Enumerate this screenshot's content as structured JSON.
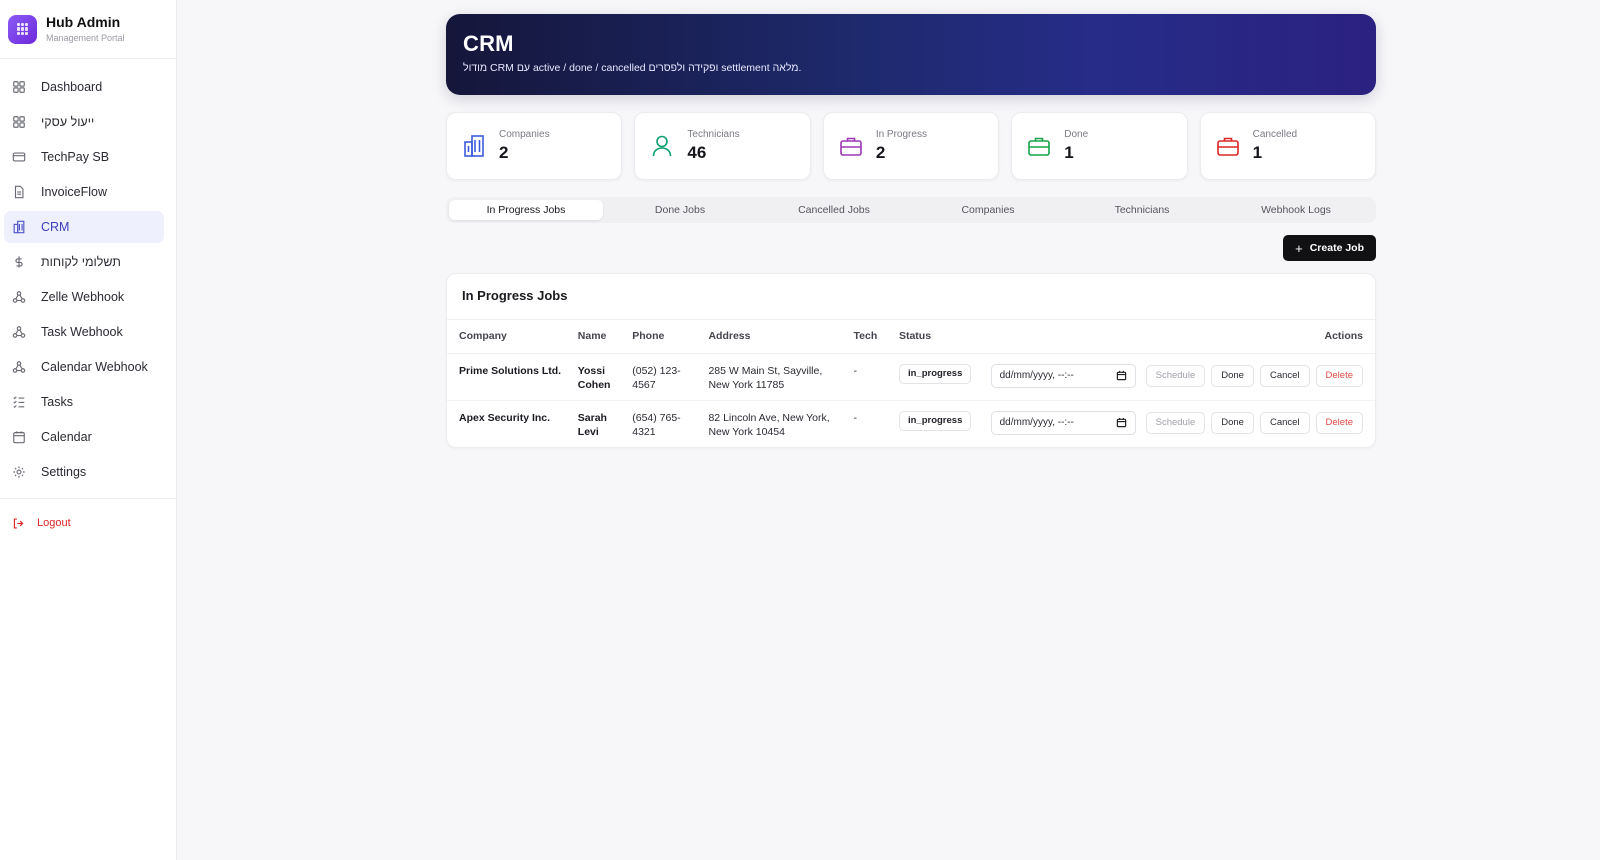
{
  "sidebar": {
    "brand": {
      "title": "Hub Admin",
      "subtitle": "Management Portal"
    },
    "items": [
      {
        "label": "Dashboard",
        "icon": "dashboard-icon",
        "active": false
      },
      {
        "label": "ייעול עסקי",
        "icon": "grid-icon",
        "active": false
      },
      {
        "label": "TechPay SB",
        "icon": "credit-card-icon",
        "active": false
      },
      {
        "label": "InvoiceFlow",
        "icon": "document-icon",
        "active": false
      },
      {
        "label": "CRM",
        "icon": "building-icon",
        "active": true
      },
      {
        "label": "תשלומי לקוחות",
        "icon": "dollar-icon",
        "active": false
      },
      {
        "label": "Zelle Webhook",
        "icon": "webhook-icon",
        "active": false
      },
      {
        "label": "Task Webhook",
        "icon": "webhook-icon",
        "active": false
      },
      {
        "label": "Calendar Webhook",
        "icon": "webhook-icon",
        "active": false
      },
      {
        "label": "Tasks",
        "icon": "list-icon",
        "active": false
      },
      {
        "label": "Calendar",
        "icon": "calendar-icon",
        "active": false
      },
      {
        "label": "Settings",
        "icon": "gear-icon",
        "active": false
      }
    ],
    "logout": "Logout"
  },
  "hero": {
    "title": "CRM",
    "subtitle": "מודול CRM עם active / done / cancelled ופקידה ולפסרים settlement מלאה."
  },
  "stats": [
    {
      "label": "Companies",
      "value": "2",
      "icon": "building-icon",
      "color": "#3b5bdb"
    },
    {
      "label": "Technicians",
      "value": "46",
      "icon": "user-icon",
      "color": "#0f9f6e"
    },
    {
      "label": "In Progress",
      "value": "2",
      "icon": "briefcase-icon",
      "color": "#9c36b5"
    },
    {
      "label": "Done",
      "value": "1",
      "icon": "briefcase-icon",
      "color": "#16a34a"
    },
    {
      "label": "Cancelled",
      "value": "1",
      "icon": "briefcase-icon",
      "color": "#dc2626"
    }
  ],
  "tabs": [
    {
      "label": "In Progress Jobs",
      "active": true
    },
    {
      "label": "Done Jobs",
      "active": false
    },
    {
      "label": "Cancelled Jobs",
      "active": false
    },
    {
      "label": "Companies",
      "active": false
    },
    {
      "label": "Technicians",
      "active": false
    },
    {
      "label": "Webhook Logs",
      "active": false
    }
  ],
  "toolbar": {
    "create_label": "Create Job"
  },
  "jobs": {
    "title": "In Progress Jobs",
    "columns": {
      "company": "Company",
      "name": "Name",
      "phone": "Phone",
      "address": "Address",
      "tech": "Tech",
      "status": "Status",
      "actions": "Actions"
    },
    "actions": {
      "schedule": "Schedule",
      "done": "Done",
      "cancel": "Cancel",
      "delete": "Delete"
    },
    "date_placeholder": "dd/mm/yyyy, --:--",
    "rows": [
      {
        "company": "Prime Solutions Ltd.",
        "name": "Yossi Cohen",
        "phone": "(052) 123-4567",
        "address": "285 W Main St, Sayville, New York 11785",
        "tech": "-",
        "status": "in_progress"
      },
      {
        "company": "Apex Security Inc.",
        "name": "Sarah Levi",
        "phone": "(654) 765-4321",
        "address": "82 Lincoln Ave, New York, New York 10454",
        "tech": "-",
        "status": "in_progress"
      }
    ]
  }
}
